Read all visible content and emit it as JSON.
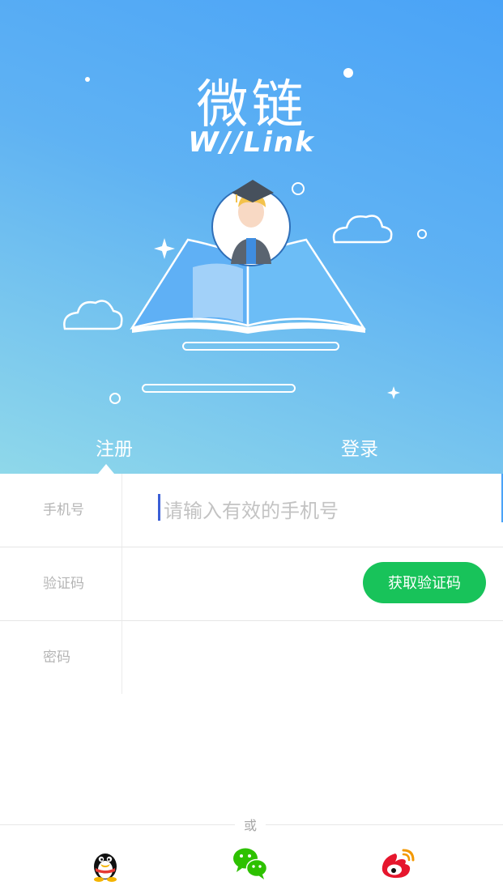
{
  "hero": {
    "title": "微链",
    "subtitle": "W//Link"
  },
  "tabs": {
    "register": "注册",
    "login": "登录",
    "active": "register"
  },
  "form": {
    "phone": {
      "label": "手机号",
      "placeholder": "请输入有效的手机号",
      "value": ""
    },
    "code": {
      "label": "验证码",
      "button": "获取验证码",
      "value": ""
    },
    "password": {
      "label": "密码",
      "value": ""
    }
  },
  "footer": {
    "or_text": "或",
    "social": [
      "qq-icon",
      "wechat-icon",
      "weibo-icon"
    ]
  },
  "colors": {
    "hero_start": "#4aa3f7",
    "hero_end": "#8fd8ea",
    "accent_green": "#18c35a",
    "caret": "#3b5fd6"
  }
}
